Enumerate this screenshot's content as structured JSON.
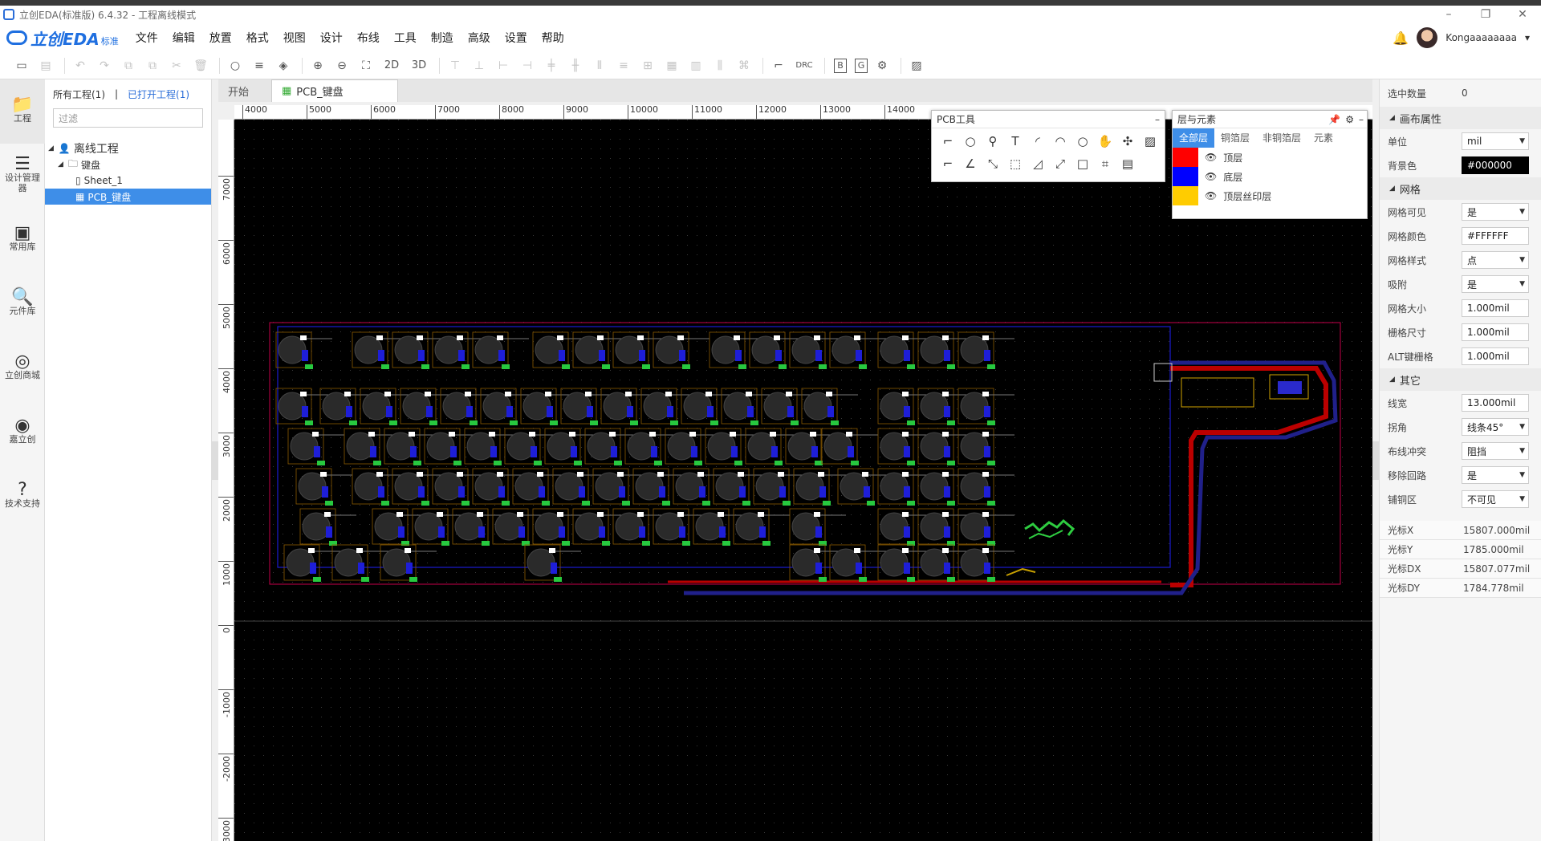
{
  "window": {
    "title": "立创EDA(标准版) 6.4.32 - 工程离线模式",
    "minimize": "–",
    "restore": "❐",
    "close": "✕"
  },
  "logo": {
    "text": "立创EDA",
    "sub": "标准"
  },
  "menu": [
    "文件",
    "编辑",
    "放置",
    "格式",
    "视图",
    "设计",
    "布线",
    "工具",
    "制造",
    "高级",
    "设置",
    "帮助"
  ],
  "user": {
    "name": "Kongaaaaaaaa",
    "bell": "🔔",
    "caret": "▾"
  },
  "toolbar": {
    "view2d": "2D",
    "view3d": "3D",
    "drc": "DRC",
    "b": "B",
    "g": "G"
  },
  "leftbar": [
    {
      "label": "工程",
      "icon": "📁"
    },
    {
      "label": "设计管理器",
      "icon": "☰"
    },
    {
      "label": "常用库",
      "icon": "▣"
    },
    {
      "label": "元件库",
      "icon": "🔍"
    },
    {
      "label": "立创商城",
      "icon": "◎"
    },
    {
      "label": "嘉立创",
      "icon": "◉"
    },
    {
      "label": "技术支持",
      "icon": "?"
    }
  ],
  "project_panel": {
    "tab_all": "所有工程(1)",
    "divider": "|",
    "tab_open": "已打开工程(1)",
    "filter_placeholder": "过滤",
    "tree": {
      "root": "离线工程",
      "project": "键盘",
      "sheet": "Sheet_1",
      "pcb": "PCB_键盘"
    }
  },
  "doc_tabs": [
    {
      "label": "开始"
    },
    {
      "label": "PCB_键盘"
    }
  ],
  "ruler_h": [
    "4000",
    "5000",
    "6000",
    "7000",
    "8000",
    "9000",
    "10000",
    "11000",
    "12000",
    "13000",
    "14000"
  ],
  "ruler_v": [
    "7000",
    "6000",
    "5000",
    "4000",
    "3000",
    "2000",
    "1000",
    "0",
    "-1000",
    "-2000",
    "-3000"
  ],
  "pcb_tools": {
    "title": "PCB工具",
    "icons": [
      "⌐",
      "○",
      "⚲",
      "T",
      "◜",
      "◠",
      "○",
      "✋",
      "✣",
      "▨",
      "⌐",
      "∠",
      "⤡",
      "⬚",
      "◿",
      "⤢",
      "□",
      "⌗",
      "▤"
    ]
  },
  "layers_panel": {
    "title": "层与元素",
    "tabs": [
      "全部层",
      "铜箔层",
      "非铜箔层",
      "元素"
    ],
    "layers": [
      {
        "name": "顶层",
        "color": "#FF0000",
        "eye": "👁"
      },
      {
        "name": "底层",
        "color": "#0000FF",
        "eye": "👁"
      },
      {
        "name": "顶层丝印层",
        "color": "#FFCC00",
        "eye": "👁"
      }
    ]
  },
  "props": {
    "selected_count_label": "选中数量",
    "selected_count": "0",
    "canvas_section": "画布属性",
    "unit_label": "单位",
    "unit": "mil",
    "bg_label": "背景色",
    "bg": "#000000",
    "grid_section": "网格",
    "grid_visible_label": "网格可见",
    "grid_visible": "是",
    "grid_color_label": "网格颜色",
    "grid_color": "#FFFFFF",
    "grid_style_label": "网格样式",
    "grid_style": "点",
    "snap_label": "吸附",
    "snap": "是",
    "grid_size_label": "网格大小",
    "grid_size": "1.000mil",
    "grid_dim_label": "栅格尺寸",
    "grid_dim": "1.000mil",
    "alt_grid_label": "ALT键栅格",
    "alt_grid": "1.000mil",
    "other_section": "其它",
    "width_label": "线宽",
    "width": "13.000mil",
    "corner_label": "拐角",
    "corner": "线条45°",
    "conflict_label": "布线冲突",
    "conflict": "阻挡",
    "loop_label": "移除回路",
    "loop": "是",
    "copper_label": "铺铜区",
    "copper": "不可见",
    "cursor_x_label": "光标X",
    "cursor_x": "15807.000mil",
    "cursor_y_label": "光标Y",
    "cursor_y": "1785.000mil",
    "cursor_dx_label": "光标DX",
    "cursor_dx": "15807.077mil",
    "cursor_dy_label": "光标DY",
    "cursor_dy": "1784.778mil"
  },
  "colors": {
    "accent": "#2A6DD8",
    "top_layer": "#FF0000",
    "bottom_layer": "#0000FF",
    "silk": "#FFCC00",
    "canvas": "#000000"
  }
}
